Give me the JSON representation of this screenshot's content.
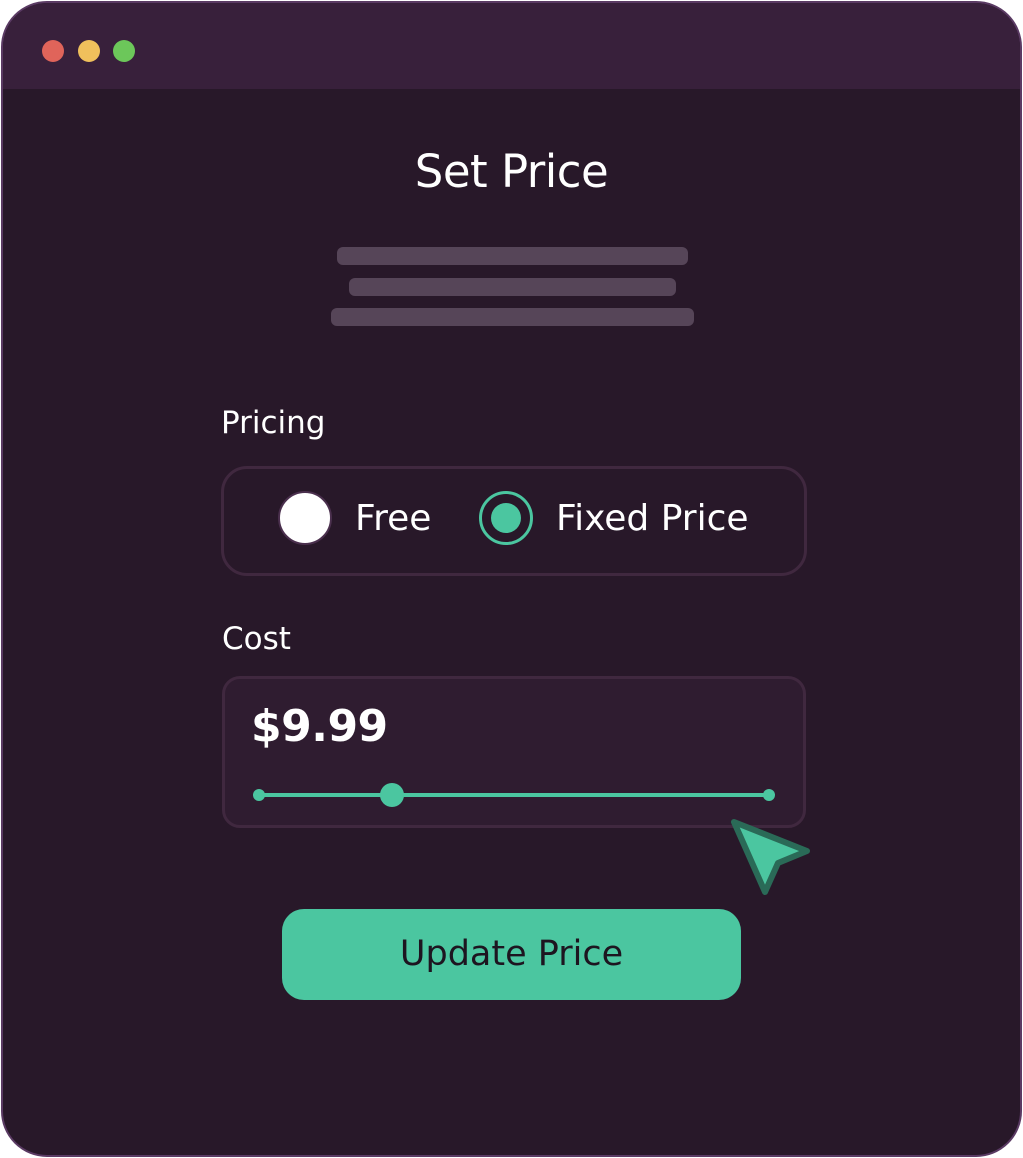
{
  "window": {
    "traffic_lights": {
      "close_color": "#e0645a",
      "minimize_color": "#f0c05c",
      "maximize_color": "#6cc75a"
    }
  },
  "dialog": {
    "title": "Set Price",
    "pricing": {
      "label": "Pricing",
      "options": [
        {
          "label": "Free",
          "selected": false
        },
        {
          "label": "Fixed Price",
          "selected": true
        }
      ]
    },
    "cost": {
      "label": "Cost",
      "value": "$9.99",
      "slider_fraction": 0.26
    },
    "update_button_label": "Update Price"
  },
  "colors": {
    "accent": "#4bc6a0",
    "background": "#281829",
    "titlebar": "#38203b"
  },
  "icons": {
    "cursor": "cursor-arrow-icon"
  }
}
